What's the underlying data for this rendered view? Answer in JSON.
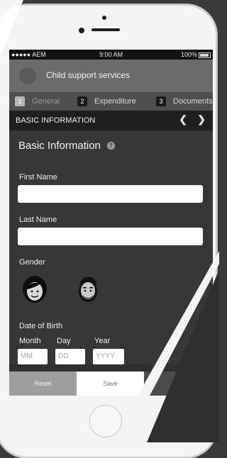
{
  "status_bar": {
    "carrier": "●●●●● AEM",
    "time": "9:00 AM",
    "battery": "100%"
  },
  "app": {
    "title": "Child support services"
  },
  "steps": [
    {
      "num": "1",
      "label": "General"
    },
    {
      "num": "2",
      "label": "Expenditure"
    },
    {
      "num": "3",
      "label": "Documents"
    }
  ],
  "section": {
    "label": "BASIC INFORMATION",
    "prev": "❮",
    "next": "❯"
  },
  "form": {
    "title": "Basic Information",
    "help": "?",
    "first_name_label": "First Name",
    "last_name_label": "Last Name",
    "gender_label": "Gender",
    "dob_label": "Date of Birth",
    "month_label": "Month",
    "day_label": "Day",
    "year_label": "Year",
    "month_placeholder": "MM",
    "day_placeholder": "DD",
    "year_placeholder": "YYYY"
  },
  "footer": {
    "reset": "Reset",
    "save": "Save"
  }
}
